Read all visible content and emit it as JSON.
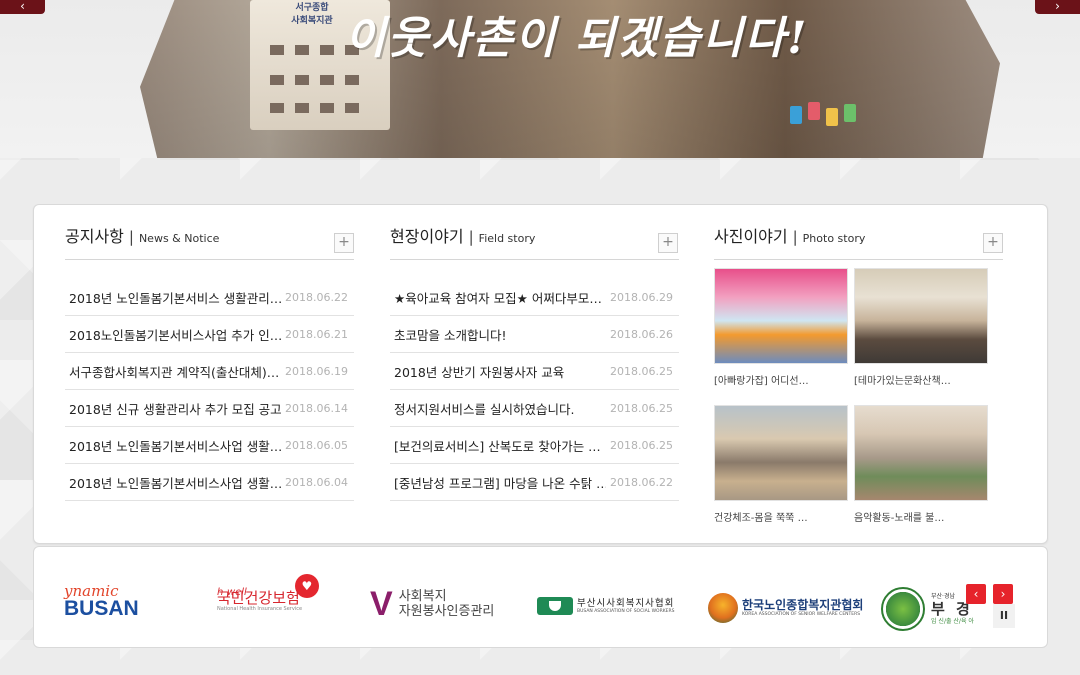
{
  "hero": {
    "title": "이웃사촌이 되겠습니다!",
    "building_sign_line1": "서구종합",
    "building_sign_line2": "사회복지관",
    "prev_icon": "chevron-left-icon",
    "next_icon": "chevron-right-icon"
  },
  "notice": {
    "title": "공지사항",
    "subtitle": "News & Notice",
    "more_label": "+",
    "items": [
      {
        "title": "2018년 노인돌봄기본서비스 생활관리…",
        "date": "2018.06.22"
      },
      {
        "title": "2018노인돌봄기본서비스사업 추가 인…",
        "date": "2018.06.21"
      },
      {
        "title": "서구종합사회복지관 계약직(출산대체)…",
        "date": "2018.06.19"
      },
      {
        "title": "2018년 신규 생활관리사 추가 모집 공고",
        "date": "2018.06.14"
      },
      {
        "title": "2018년 노인돌봄기본서비스사업 생활…",
        "date": "2018.06.05"
      },
      {
        "title": "2018년 노인돌봄기본서비스사업 생활…",
        "date": "2018.06.04"
      }
    ]
  },
  "field": {
    "title": "현장이야기",
    "subtitle": "Field story",
    "more_label": "+",
    "items": [
      {
        "title": "★육아교육 참여자 모집★ 어쩌다부모…",
        "date": "2018.06.29"
      },
      {
        "title": "초코맘을 소개합니다!",
        "date": "2018.06.26"
      },
      {
        "title": "2018년 상반기 자원봉사자 교육",
        "date": "2018.06.25"
      },
      {
        "title": "정서지원서비스를 실시하였습니다.",
        "date": "2018.06.25"
      },
      {
        "title": "[보건의료서비스] 산복도로 찾아가는 …",
        "date": "2018.06.25"
      },
      {
        "title": "[중년남성 프로그램] 마당을 나온 수탉 …",
        "date": "2018.06.22"
      }
    ]
  },
  "photo": {
    "title": "사진이야기",
    "subtitle": "Photo story",
    "more_label": "+",
    "items": [
      {
        "caption": "[아빠랑가잡] 어디선…"
      },
      {
        "caption": "[테마가있는문화산책…"
      },
      {
        "caption": "건강체조-몸을 쭉쭉 …"
      },
      {
        "caption": "음악활동-노래를 불…"
      }
    ]
  },
  "partners": {
    "logos": [
      {
        "line1": "ynamic",
        "line2": "BUSAN"
      },
      {
        "line1": "h-well",
        "line2": "국민건강보험",
        "line3": "National Health Insurance Service"
      },
      {
        "line1": "사회복지",
        "line2": "자원봉사인증관리"
      },
      {
        "line1": "부산시사회복지사협회",
        "line2": "BUSAN ASSOCIATION OF SOCIAL WORKERS"
      },
      {
        "line1": "한국노인종합복지관협회",
        "line2": "KOREA ASSOCIATION OF SENIOR WELFARE CENTERS"
      },
      {
        "line1": "부산·경남",
        "line2": "부 경",
        "line3": "임 신/출 산/육 아"
      }
    ],
    "prev_icon": "chevron-left-icon",
    "next_icon": "chevron-right-icon",
    "pause_label": "II"
  },
  "colors": {
    "accent": "#6b1218",
    "control_red": "#e6232b",
    "date_gray": "#b3b3b3"
  }
}
